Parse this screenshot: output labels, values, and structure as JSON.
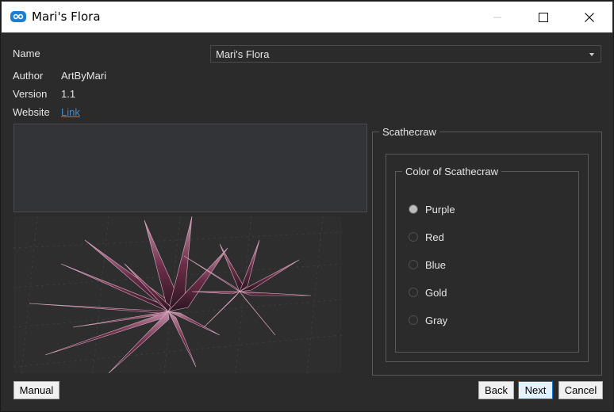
{
  "window": {
    "title": "Mari's Flora"
  },
  "fields": {
    "name_label": "Name",
    "name_value": "Mari's Flora",
    "author_label": "Author",
    "author_value": "ArtByMari",
    "version_label": "Version",
    "version_value": "1.1",
    "website_label": "Website",
    "website_link": "Link"
  },
  "option_group": {
    "title": "Scathecraw",
    "inner_title": "Color of Scathecraw",
    "options": [
      {
        "label": "Purple",
        "checked": true
      },
      {
        "label": "Red",
        "checked": false
      },
      {
        "label": "Blue",
        "checked": false
      },
      {
        "label": "Gold",
        "checked": false
      },
      {
        "label": "Gray",
        "checked": false
      }
    ]
  },
  "buttons": {
    "manual": "Manual",
    "back": "Back",
    "next": "Next",
    "cancel": "Cancel"
  },
  "colors": {
    "background": "#2b2b2b",
    "link": "#3d8fd6",
    "plant": "#5a2a3e"
  }
}
